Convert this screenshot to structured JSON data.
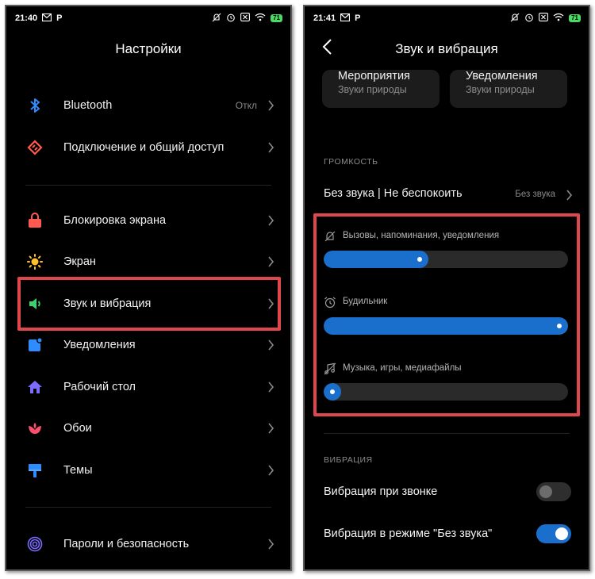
{
  "status_left": {
    "time": "21:40",
    "app_glyph": "P"
  },
  "status_right": {
    "time": "21:41",
    "app_glyph": "P"
  },
  "battery": "71",
  "settings": {
    "title": "Настройки",
    "items": [
      {
        "label": "Bluetooth",
        "value": "Откл",
        "icon": "bluetooth-icon",
        "color": "#2f8cff"
      },
      {
        "label": "Подключение и общий доступ",
        "value": "",
        "icon": "share-icon",
        "color": "#ff5a4a"
      },
      {
        "label": "Блокировка экрана",
        "value": "",
        "icon": "lock-icon",
        "color": "#ff5a52"
      },
      {
        "label": "Экран",
        "value": "",
        "icon": "sun-icon",
        "color": "#ffc02a"
      },
      {
        "label": "Звук и вибрация",
        "value": "",
        "icon": "speaker-icon",
        "color": "#3fcf6e"
      },
      {
        "label": "Уведомления",
        "value": "",
        "icon": "notification-icon",
        "color": "#2f8cff"
      },
      {
        "label": "Рабочий стол",
        "value": "",
        "icon": "home-icon",
        "color": "#7b6bff"
      },
      {
        "label": "Обои",
        "value": "",
        "icon": "flower-icon",
        "color": "#ff4f6d"
      },
      {
        "label": "Темы",
        "value": "",
        "icon": "brush-icon",
        "color": "#2f8cff"
      },
      {
        "label": "Пароли и безопасность",
        "value": "",
        "icon": "fingerprint-icon",
        "color": "#7b6bff"
      }
    ]
  },
  "sound": {
    "title": "Звук и вибрация",
    "cards": [
      {
        "title": "Мероприятия",
        "sub": "Звуки природы"
      },
      {
        "title": "Уведомления",
        "sub": "Звуки природы"
      }
    ],
    "volume_header": "ГРОМКОСТЬ",
    "silent_label": "Без звука | Не беспокоить",
    "silent_value": "Без звука",
    "sliders": [
      {
        "label": "Вызовы, напоминания, уведомления",
        "icon": "bell-muted-icon",
        "level": 0.43
      },
      {
        "label": "Будильник",
        "icon": "alarm-clock-icon",
        "level": 1.0
      },
      {
        "label": "Музыка, игры, медиафайлы",
        "icon": "music-note-icon",
        "level": 0.0
      }
    ],
    "vibration_header": "ВИБРАЦИЯ",
    "vibration_rows": [
      {
        "label": "Вибрация при звонке",
        "on": false
      },
      {
        "label": "Вибрация в режиме \"Без звука\"",
        "on": true
      }
    ]
  },
  "colors": {
    "accent": "#1a6fcd",
    "highlight": "#e0474c",
    "background": "#000000"
  }
}
